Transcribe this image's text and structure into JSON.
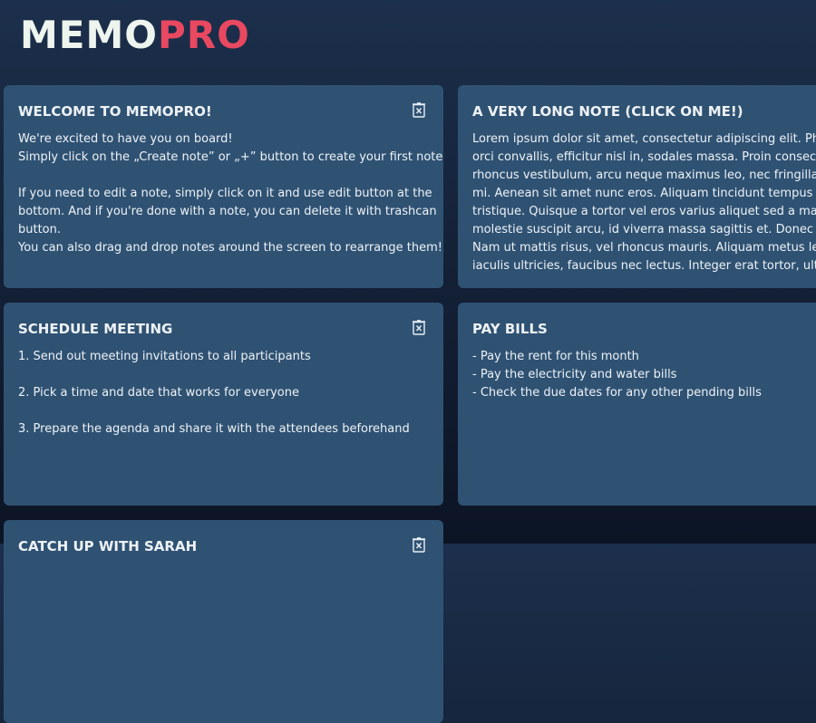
{
  "logo": {
    "memo": "MEMO",
    "pro": "PRO"
  },
  "notes": [
    {
      "title": "WELCOME TO MEMOPRO!",
      "lines": [
        "We're excited to have you on board!",
        "Simply click on the „Create note” or „+” button to create your first note.",
        "",
        "If you need to edit a note, simply click on it and use edit button at the",
        "bottom. And if you're done with a note, you can delete it with trashcan",
        "button.",
        "You can also drag and drop notes around the screen to rearrange them!"
      ]
    },
    {
      "title": "A VERY LONG NOTE (CLICK ON ME!)",
      "lines": [
        "Lorem ipsum dolor sit amet, consectetur adipiscing elit. Phase",
        "orci convallis, efficitur nisl in, sodales massa. Proin consectetu",
        "rhoncus vestibulum, arcu neque maximus leo, nec fringilla pur",
        "mi. Aenean sit amet nunc eros. Aliquam tincidunt tempus lore",
        "tristique. Quisque a tortor vel eros varius aliquet sed a massa.",
        "molestie suscipit arcu, id viverra massa sagittis et. Donec id lac",
        "Nam ut mattis risus, vel rhoncus mauris. Aliquam metus leo, c",
        "iaculis ultricies, faucibus nec lectus. Integer erat tortor, ultricie"
      ]
    },
    {
      "title": "SCHEDULE MEETING",
      "lines": [
        "1. Send out meeting invitations to all participants",
        "",
        "2. Pick a time and date that works for everyone",
        "",
        "3. Prepare the agenda and share it with the attendees beforehand"
      ]
    },
    {
      "title": "PAY BILLS",
      "lines": [
        "- Pay the rent for this month",
        "- Pay the electricity and water bills",
        "- Check the due dates for any other pending bills"
      ]
    },
    {
      "title": "CATCH UP WITH SARAH",
      "lines": []
    }
  ],
  "icons": {
    "delete": "trash-icon"
  },
  "colors": {
    "background_top": "#1c2f4c",
    "background_bottom": "#0c1424",
    "note_background": "#2f5273",
    "note_text": "#eef2f6",
    "logo_primary": "#eef5ef",
    "logo_accent": "#e84860"
  }
}
